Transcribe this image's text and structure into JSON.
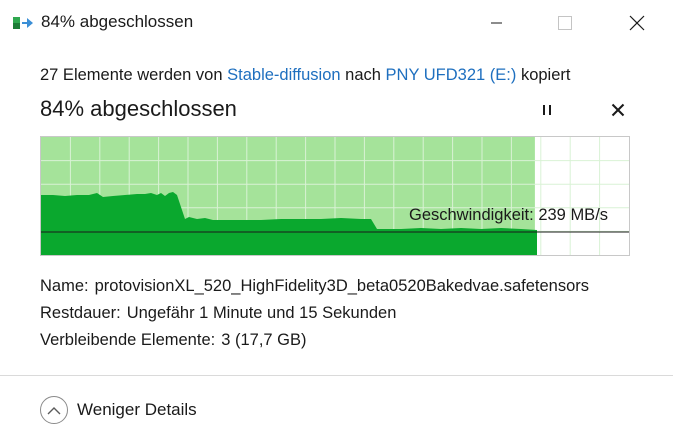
{
  "window": {
    "title": "84% abgeschlossen",
    "icon": "copy-progress-icon"
  },
  "copy": {
    "prefix": "27 Elemente werden von",
    "source": "Stable-diffusion",
    "middle": "nach",
    "destination": "PNY UFD321 (E:)",
    "suffix": "kopiert"
  },
  "progress": {
    "title": "84% abgeschlossen",
    "percent": 84,
    "speed_label": "Geschwindigkeit:",
    "speed_value": "239 MB/s"
  },
  "details": {
    "name_label": "Name:",
    "name_value": "protovisionXL_520_HighFidelity3D_beta0520Bakedvae.safetensors",
    "time_label": "Restdauer:",
    "time_value": "Ungefähr 1 Minute und 15 Sekunden",
    "items_label": "Verbleibende Elemente:",
    "items_value": "3 (17,7 GB)"
  },
  "toggle": {
    "label": "Weniger Details"
  },
  "colors": {
    "progress_fill": "#a5e39a",
    "speed_area": "#0aa82e",
    "grid": "#d9f2d5",
    "link": "#1e6fbf"
  }
}
